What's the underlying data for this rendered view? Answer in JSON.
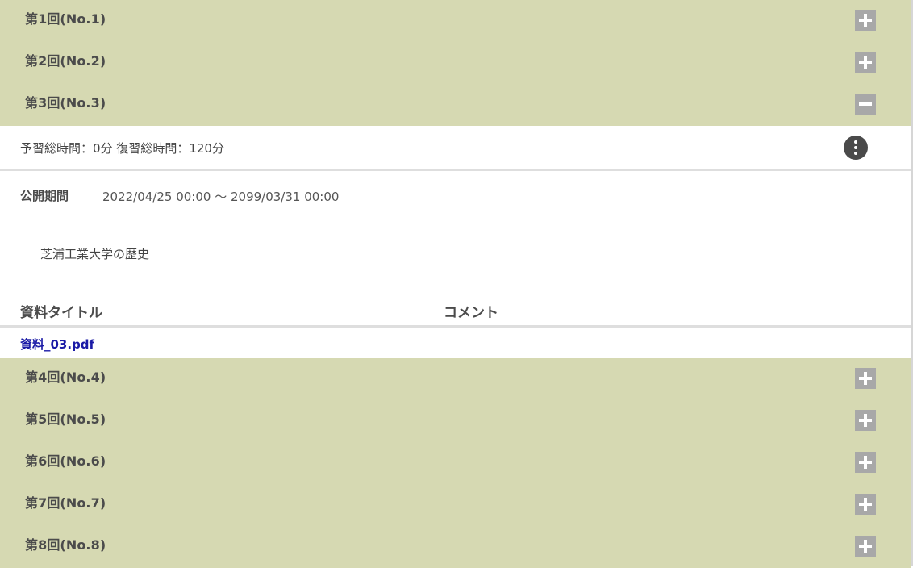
{
  "sessions_before": [
    {
      "title": "第1回(No.1)",
      "toggle": "plus-icon"
    },
    {
      "title": "第2回(No.2)",
      "toggle": "plus-icon"
    }
  ],
  "open_session": {
    "title": "第3回(No.3)",
    "toggle": "minus-icon",
    "study_time": "予習総時間：0分 復習総時間：120分",
    "period_label": "公開期間",
    "period_value": "2022/04/25 00:00 ～ 2099/03/31 00:00",
    "description": "芝浦工業大学の歴史",
    "materials": {
      "headers": {
        "title": "資料タイトル",
        "comment": "コメント"
      },
      "rows": [
        {
          "title": "資料_03.pdf",
          "comment": ""
        }
      ]
    }
  },
  "sessions_after": [
    {
      "title": "第4回(No.4)",
      "toggle": "plus-icon"
    },
    {
      "title": "第5回(No.5)",
      "toggle": "plus-icon"
    },
    {
      "title": "第6回(No.6)",
      "toggle": "plus-icon"
    },
    {
      "title": "第7回(No.7)",
      "toggle": "plus-icon"
    },
    {
      "title": "第8回(No.8)",
      "toggle": "plus-icon"
    }
  ],
  "colors": {
    "header_bg": "#d6d9b2",
    "toggle_bg": "#a8a8a8",
    "link": "#1a1aa6",
    "menu_button": "#4a4a4a"
  }
}
